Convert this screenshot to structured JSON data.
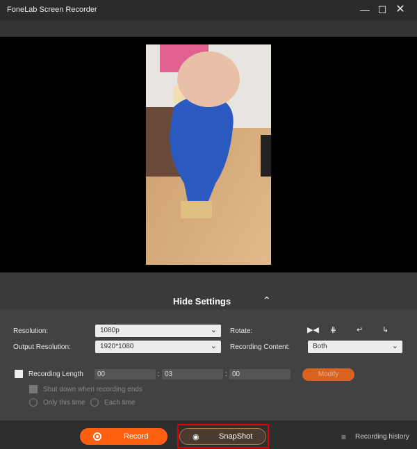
{
  "window": {
    "title": "FoneLab Screen Recorder"
  },
  "preview": {
    "hide_settings_label": "Hide Settings"
  },
  "settings": {
    "resolution_label": "Resolution:",
    "resolution_value": "1080p",
    "output_resolution_label": "Output Resolution:",
    "output_resolution_value": "1920*1080",
    "rotate_label": "Rotate:",
    "recording_content_label": "Recording Content:",
    "recording_content_value": "Both",
    "recording_length_label": "Recording Length",
    "recording_length_checked": false,
    "hours": "00",
    "minutes": "03",
    "seconds": "00",
    "sep": ":",
    "modify_label": "Modify",
    "shutdown_label": "Shut down when recording ends",
    "only_this_time_label": "Only this time",
    "each_time_label": "Each time"
  },
  "bottom": {
    "record_label": "Record",
    "snapshot_label": "SnapShot",
    "history_label": "Recording history"
  },
  "colors": {
    "accent": "#ff6010",
    "highlight": "#e00000"
  }
}
